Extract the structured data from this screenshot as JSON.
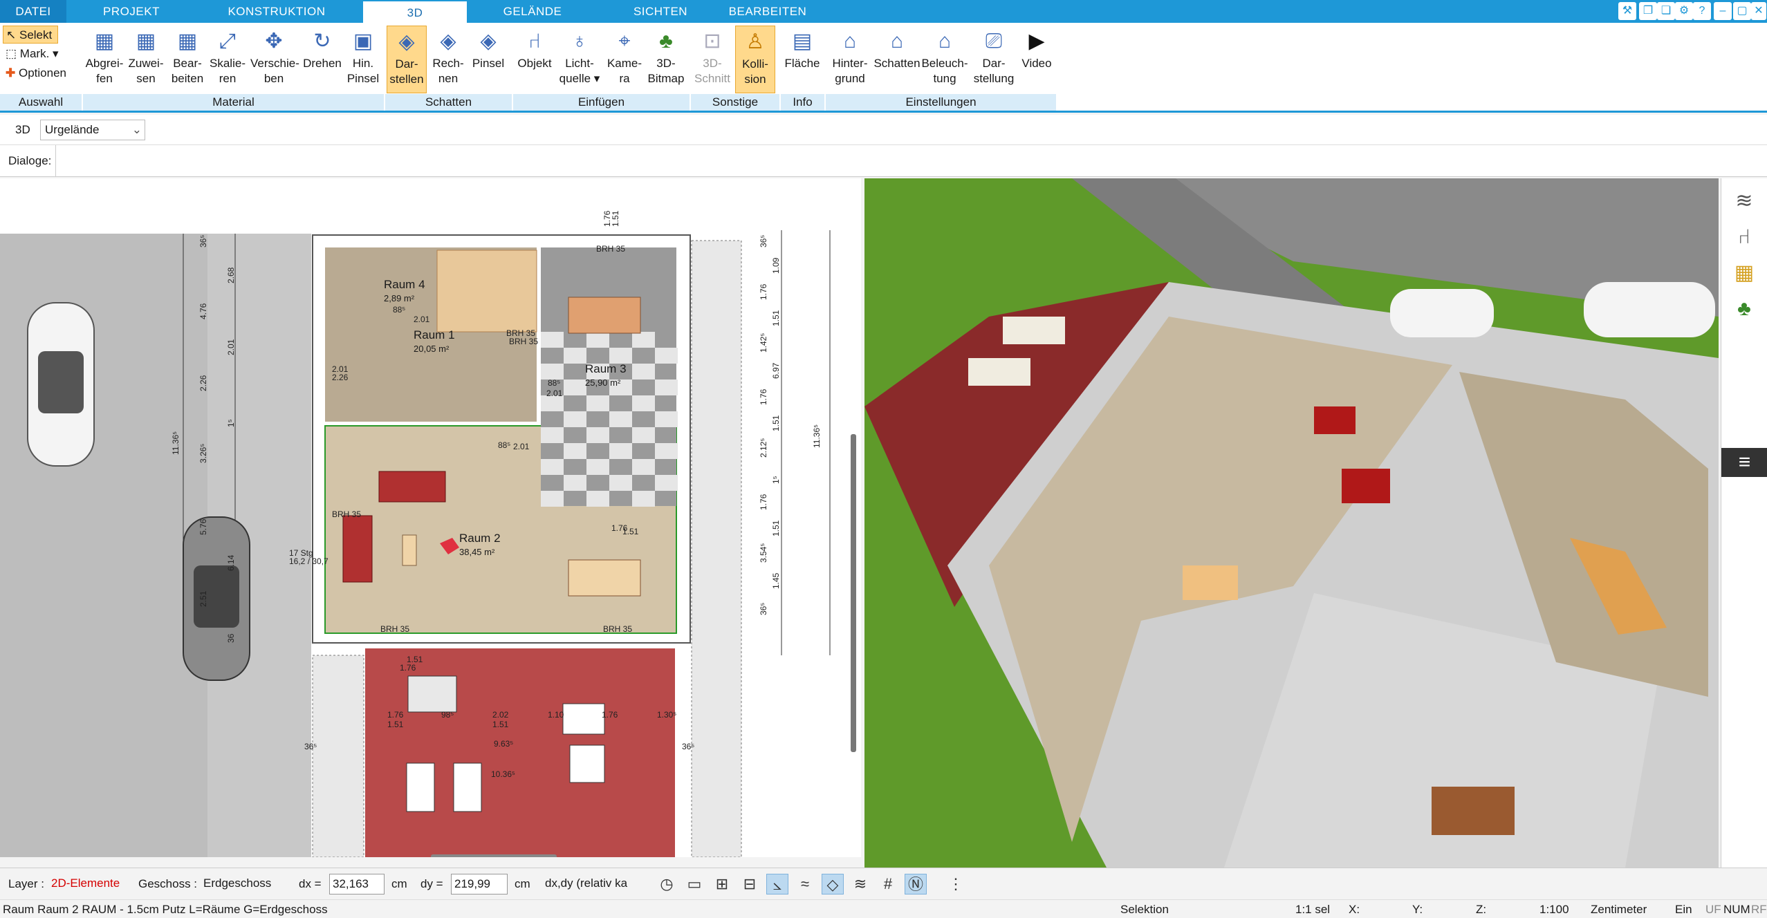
{
  "tabs": {
    "file": "DATEI",
    "projekt": "PROJEKT",
    "konstruktion": "KONSTRUKTION",
    "d3": "3D",
    "gelaende": "GELÄNDE",
    "sichten": "SICHTEN",
    "bearbeiten": "BEARBEITEN"
  },
  "auswahl": {
    "selekt": "Selekt",
    "mark": "Mark.",
    "optionen": "Optionen",
    "label": "Auswahl"
  },
  "material": {
    "label": "Material",
    "b1a": "Abgrei-",
    "b1b": "fen",
    "b2a": "Zuwei-",
    "b2b": "sen",
    "b3a": "Bear-",
    "b3b": "beiten",
    "b4a": "Skalie-",
    "b4b": "ren",
    "b5a": "Verschie-",
    "b5b": "ben",
    "b6a": "Drehen",
    "b6b": "",
    "b7a": "Hin.",
    "b7b": "Pinsel"
  },
  "schatten": {
    "label": "Schatten",
    "b1a": "Dar-",
    "b1b": "stellen",
    "b2a": "Rech-",
    "b2b": "nen",
    "b3a": "Pinsel",
    "b3b": ""
  },
  "einfuegen": {
    "label": "Einfügen",
    "b1a": "Objekt",
    "b1b": "",
    "b2a": "Licht-",
    "b2b": "quelle ▾",
    "b3a": "Kame-",
    "b3b": "ra",
    "b4a": "3D-",
    "b4b": "Bitmap"
  },
  "sonstige": {
    "label": "Sonstige",
    "b1a": "3D-",
    "b1b": "Schnitt",
    "b2a": "Kolli-",
    "b2b": "sion"
  },
  "info": {
    "label": "Info",
    "b1a": "Fläche",
    "b1b": ""
  },
  "einstellungen": {
    "label": "Einstellungen",
    "b1a": "Hinter-",
    "b1b": "grund",
    "b2a": "Schatten",
    "b2b": "",
    "b3a": "Beleuch-",
    "b3b": "tung",
    "b4a": "Dar-",
    "b4b": "stellung",
    "b5a": "Video",
    "b5b": ""
  },
  "view": {
    "mode": "3D",
    "terrain": "Urgelände",
    "dialoge": "Dialoge:"
  },
  "plan": {
    "rooms": [
      {
        "name": "Raum 4",
        "area": "2,89 m²"
      },
      {
        "name": "Raum 1",
        "area": "20,05 m²"
      },
      {
        "name": "Raum 3",
        "area": "25,90 m²"
      },
      {
        "name": "Raum 2",
        "area": "38,45 m²"
      }
    ],
    "dims_right": [
      "36⁵",
      "1.09",
      "1.76",
      "1.51",
      "1.42⁵",
      "6.97",
      "1.76",
      "1.51",
      "2.12⁵",
      "1⁵",
      "1.76",
      "1.51",
      "3.54⁵",
      "1.45",
      "36⁵",
      "11.36⁵"
    ],
    "dims_left": [
      "36⁵",
      "2.68",
      "4.76",
      "2.01",
      "2.26",
      "1⁵",
      "3.26⁵",
      "11.36⁵",
      "5.76",
      "6.14",
      "2.51",
      "36"
    ],
    "dims_top": [
      "1.76",
      "1.51"
    ],
    "dims_misc": [
      "2.01",
      "2.26",
      "88⁵",
      "2.01",
      "88⁵",
      "2.01",
      "88⁵",
      "2.01",
      "1.76",
      "1.51",
      "17 Stg",
      "16,2 / 30,7",
      "BRH 35",
      "BRH 35",
      "BRH 35",
      "BRH 35",
      "BRH 35",
      "BRH 35"
    ],
    "dims_terrace": [
      "1.76",
      "1.51",
      "1.76",
      "1.51",
      "98⁵",
      "2.02",
      "1.51",
      "1.10",
      "1.76",
      "1.30⁵",
      "9.63⁵",
      "10.36⁵",
      "36⁵",
      "36⁵"
    ]
  },
  "status": {
    "layer_label": "Layer :",
    "layer_value": "2D-Elemente",
    "layer_color": "#d40000",
    "geschoss_label": "Geschoss :",
    "geschoss_value": "Erdgeschoss",
    "dx_label": "dx =",
    "dx_value": "32,163",
    "dx_unit": "cm",
    "dy_label": "dy =",
    "dy_value": "219,99",
    "dy_unit": "cm",
    "mode_value": "dx,dy (relativ ka"
  },
  "footer": {
    "info": "Raum Raum 2 RAUM - 1.5cm Putz L=Räume G=Erdgeschoss",
    "selektion": "Selektion",
    "sel": "1:1 sel",
    "x": "X:",
    "y": "Y:",
    "z": "Z:",
    "scale": "1:100",
    "unit": "Zentimeter",
    "ein": "Ein",
    "uf": "UF",
    "num": "NUM",
    "rf": "RF"
  },
  "colors": {
    "accent": "#1e98d7",
    "active": "#ffd98c",
    "terrace": "#b84a4a",
    "grass": "#5f9a2a"
  }
}
